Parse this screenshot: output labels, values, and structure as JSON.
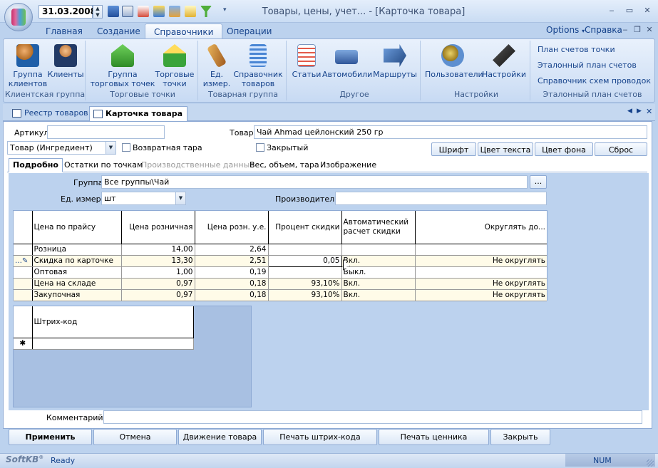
{
  "window": {
    "title": "Товары, цены, учет... - [Карточка товара]",
    "date": "31.03.2008",
    "controls": [
      "‒",
      "▭",
      "✕"
    ]
  },
  "ribbon_tabs": [
    {
      "label": "Главная"
    },
    {
      "label": "Создание"
    },
    {
      "label": "Справочники"
    },
    {
      "label": "Операции"
    }
  ],
  "right_menu": {
    "options": "Options",
    "help": "Справка"
  },
  "ribbon": {
    "client_group": {
      "label": "Клиентская группа",
      "buttons": [
        "Группа\nклиентов",
        "Клиенты"
      ]
    },
    "points_group": {
      "label": "Торговые точки",
      "buttons": [
        "Группа\nторговых точек",
        "Торговые\nточки"
      ]
    },
    "goods_group": {
      "label": "Товарная группа",
      "buttons": [
        "Ед.\nизмер.",
        "Справочник\nтоваров"
      ]
    },
    "other_group": {
      "label": "Другое",
      "buttons": [
        "Статьи",
        "Автомобили",
        "Маршруты"
      ]
    },
    "settings_group": {
      "label": "Настройки",
      "buttons": [
        "Пользователи",
        "Настройки"
      ]
    },
    "chart_group": {
      "label": "Эталонный план счетов",
      "links": [
        "План счетов точки",
        "Эталонный план счетов",
        "Справочник схем проводок"
      ]
    }
  },
  "doc_tabs": [
    {
      "label": "Реестр товаров"
    },
    {
      "label": "Карточка товара"
    }
  ],
  "form": {
    "article_label": "Артикул",
    "article_value": "",
    "product_label": "Товар",
    "product_value": "Чай Ahmad цейлонский 250 гр",
    "type_value": "Товар (Ингредиент)",
    "returnable_label": "Возвратная тара",
    "closed_label": "Закрытый",
    "style_buttons": [
      "Шрифт",
      "Цвет текста",
      "Цвет фона",
      "Сброс"
    ],
    "group_label": "Группа",
    "group_value": "Все группы\\Чай",
    "group_btn": "...",
    "unit_label": "Ед. измер.",
    "unit_value": "шт",
    "maker_label": "Производитель:",
    "maker_value": "",
    "comment_label": "Комментарий",
    "comment_value": ""
  },
  "sub_tabs": [
    {
      "label": "Подробно"
    },
    {
      "label": "Остатки по точкам"
    },
    {
      "label": "Производственные данные"
    },
    {
      "label": "Вес, объем, тара"
    },
    {
      "label": "Изображение"
    }
  ],
  "price_table": {
    "headers": [
      "Цена по прайсу",
      "Цена розничная",
      "Цена розн. у.е.",
      "Процент скидки",
      "Автоматический расчет скидки",
      "Округлять до..."
    ],
    "rows": [
      [
        "Розница",
        "14,00",
        "2,64",
        "",
        "",
        ""
      ],
      [
        "Скидка по карточке",
        "13,30",
        "2,51",
        "0,05",
        "Вкл.",
        "Не округлять"
      ],
      [
        "Оптовая",
        "1,00",
        "0,19",
        "",
        "Выкл.",
        ""
      ],
      [
        "Цена на складе",
        "0,97",
        "0,18",
        "93,10%",
        "Вкл.",
        "Не округлять"
      ],
      [
        "Закупочная",
        "0,97",
        "0,18",
        "93,10%",
        "Вкл.",
        "Не округлять"
      ]
    ]
  },
  "barcode_table": {
    "header": "Штрих-код",
    "new_row_marker": "✱"
  },
  "footer_buttons": [
    "Применить",
    "Отмена",
    "Движение товара",
    "Печать штрих-кода",
    "Печать ценника",
    "Закрыть"
  ],
  "status": {
    "brand": "SoftKB",
    "text": "Ready",
    "num": "NUM"
  }
}
